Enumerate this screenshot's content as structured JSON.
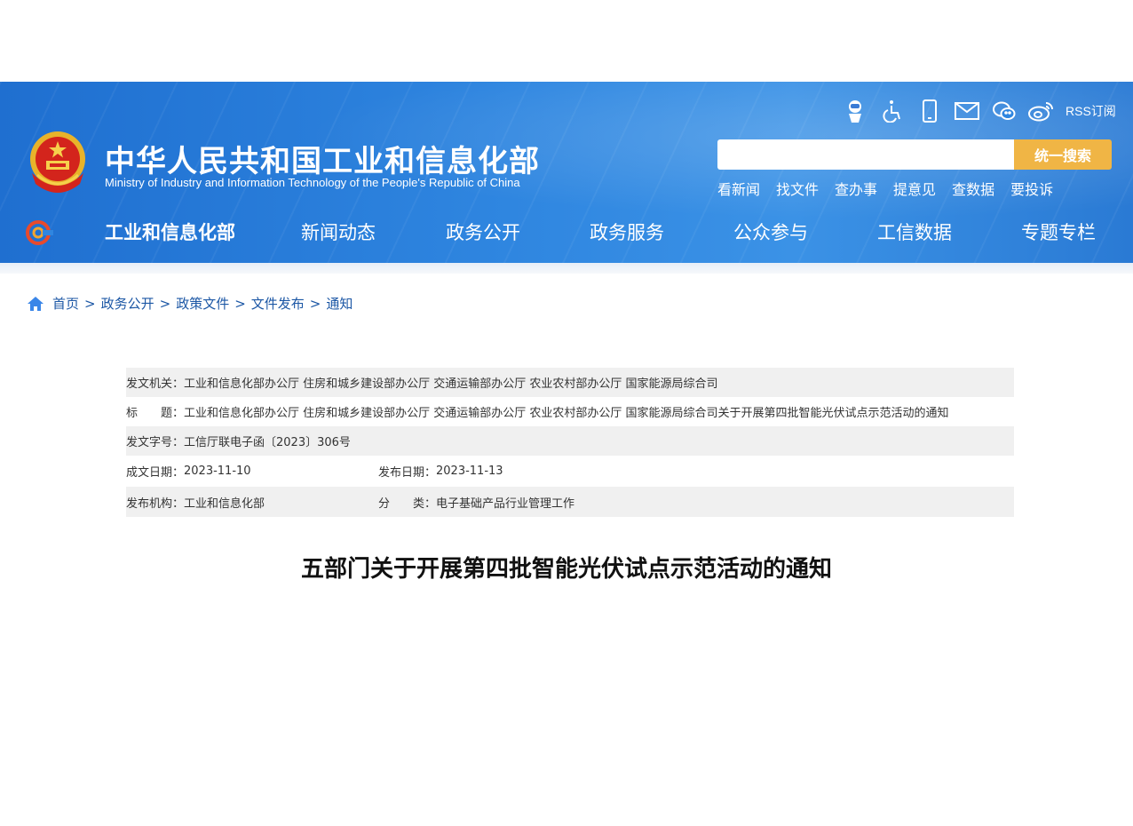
{
  "header": {
    "ministry_cn": "中华人民共和国工业和信息化部",
    "ministry_en": "Ministry of Industry and Information Technology of the People's Republic of China",
    "rss_label": "RSS订阅",
    "tool_icons": [
      "robot-icon",
      "accessibility-icon",
      "mobile-icon",
      "mail-icon",
      "wechat-icon",
      "weibo-icon"
    ],
    "search_button": "统一搜索",
    "search_value": "",
    "quick_links": [
      "看新闻",
      "找文件",
      "查办事",
      "提意见",
      "查数据",
      "要投诉"
    ],
    "colors": {
      "banner": "#2f86e0",
      "search_button": "#f0b545",
      "link": "#1c57a5"
    }
  },
  "nav": {
    "items": [
      "工业和信息化部",
      "新闻动态",
      "政务公开",
      "政务服务",
      "公众参与",
      "工信数据",
      "专题专栏"
    ]
  },
  "breadcrumb": [
    "首页",
    "政务公开",
    "政策文件",
    "文件发布",
    "通知"
  ],
  "breadcrumb_sep": ">",
  "meta": {
    "issuer_label": "发文机关：",
    "issuer": "工业和信息化部办公厅 住房和城乡建设部办公厅 交通运输部办公厅 农业农村部办公厅 国家能源局综合司",
    "title_label": "标　　题：",
    "title": "工业和信息化部办公厅 住房和城乡建设部办公厅 交通运输部办公厅 农业农村部办公厅 国家能源局综合司关于开展第四批智能光伏试点示范活动的通知",
    "doc_no_label": "发文字号：",
    "doc_no": "工信厅联电子函〔2023〕306号",
    "written_label": "成文日期：",
    "written_date": "2023-11-10",
    "published_label": "发布日期：",
    "published_date": "2023-11-13",
    "org_label": "发布机构：",
    "org": "工业和信息化部",
    "category_label": "分　　类：",
    "category": "电子基础产品行业管理工作"
  },
  "article": {
    "title": "五部门关于开展第四批智能光伏试点示范活动的通知"
  }
}
